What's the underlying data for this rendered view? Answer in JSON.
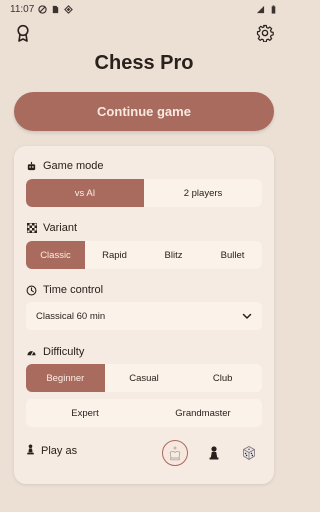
{
  "status": {
    "time": "11:07"
  },
  "header": {
    "title": "Chess Pro",
    "icons": {
      "left": "award-icon",
      "right": "gear-icon"
    }
  },
  "continue_label": "Continue game",
  "game_mode": {
    "label": "Game mode",
    "options": [
      "vs AI",
      "2 players"
    ],
    "selected": "vs AI"
  },
  "variant": {
    "label": "Variant",
    "options": [
      "Classic",
      "Rapid",
      "Blitz",
      "Bullet"
    ],
    "selected": "Classic"
  },
  "time_control": {
    "label": "Time control",
    "value": "Classical 60 min"
  },
  "difficulty": {
    "label": "Difficulty",
    "row1": [
      "Beginner",
      "Casual",
      "Club"
    ],
    "row2": [
      "Expert",
      "Grandmaster"
    ],
    "selected": "Beginner"
  },
  "play_as": {
    "label": "Play as",
    "options": [
      "white-king-icon",
      "black-pawn-icon",
      "dice-icon"
    ],
    "selected": "white-king-icon"
  },
  "colors": {
    "accent": "#a96b5e",
    "background": "#ece0d5",
    "card": "#f5ebe2"
  }
}
